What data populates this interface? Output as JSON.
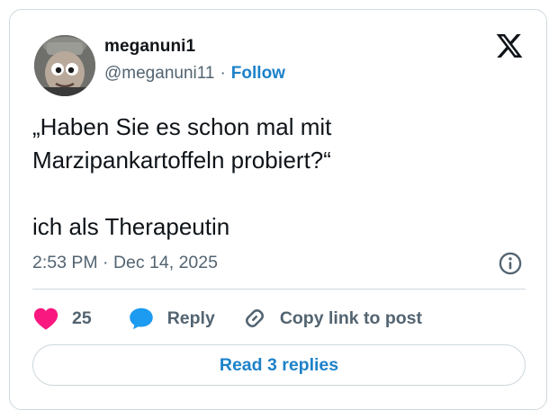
{
  "author": {
    "display_name": "meganuni1",
    "handle": "@meganuni11",
    "separator": "·",
    "follow_label": "Follow"
  },
  "tweet": {
    "lines": [
      "„Haben Sie es schon mal mit",
      "Marzipankartoffeln probiert?“",
      "",
      "ich als Therapeutin"
    ],
    "timestamp": "2:53 PM · Dec 14, 2025"
  },
  "actions": {
    "like_count": "25",
    "reply_label": "Reply",
    "copy_link_label": "Copy link to post"
  },
  "read_replies_label": "Read 3 replies",
  "icons": {
    "brand": "x-logo-icon",
    "info": "info-icon",
    "like": "heart-icon",
    "reply": "speech-bubble-icon",
    "copy": "link-icon"
  },
  "colors": {
    "accent": "#1d82c9",
    "like": "#f91880",
    "reply": "#1d9bf0",
    "muted_text": "#536471",
    "border": "#cfd9de"
  }
}
